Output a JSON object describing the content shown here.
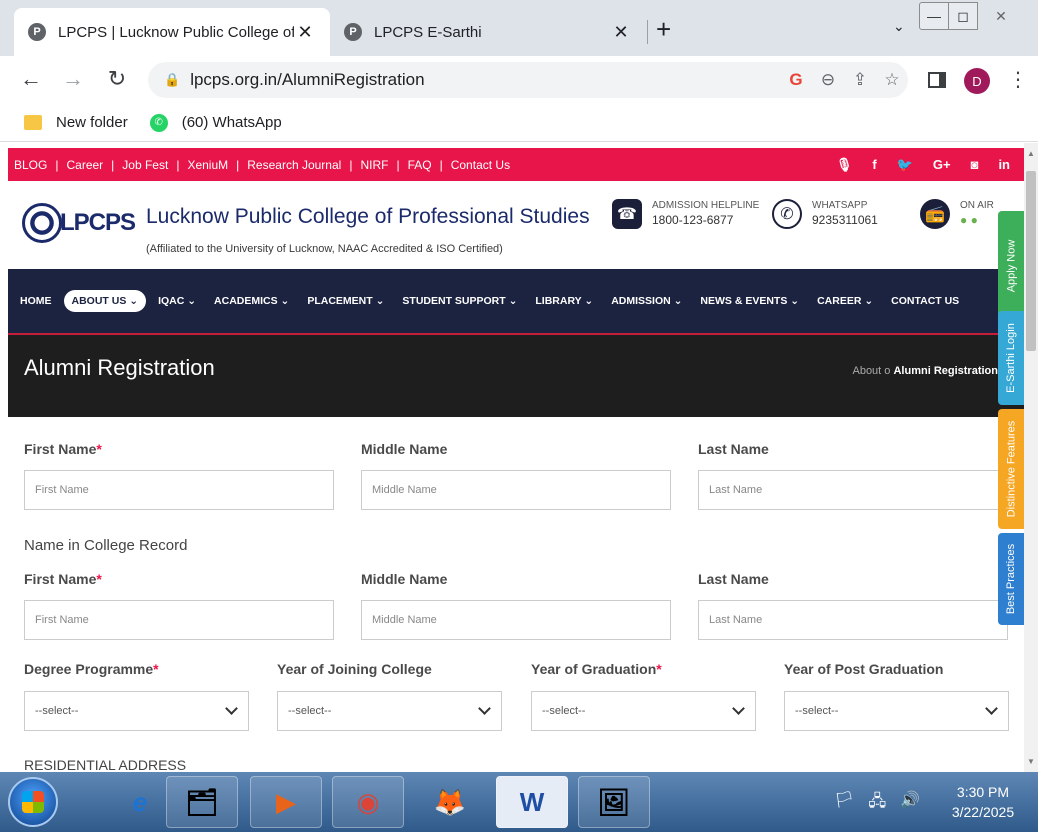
{
  "browser": {
    "tabs": [
      {
        "title": "LPCPS | Lucknow Public College of Professional Studies",
        "favicon": "P",
        "active": true
      },
      {
        "title": "LPCPS E-Sarthi",
        "favicon": "P",
        "active": false
      }
    ],
    "new_tab_symbol": "+",
    "close_symbol": "✕",
    "tab_search_symbol": "⌄",
    "window_controls": {
      "minimize": "—",
      "maximize": "◻",
      "close": "✕"
    },
    "nav": {
      "back": "←",
      "forward": "→",
      "reload": "↻"
    },
    "url": "lpcps.org.in/AlumniRegistration",
    "omnibox_icons": {
      "google": "G",
      "zoom": "⊖",
      "share": "⇪",
      "star": "☆"
    },
    "profile_initial": "D",
    "menu_symbol": "⋮",
    "bookmarks": [
      {
        "label": "New folder",
        "icon": "folder-icon"
      },
      {
        "label": "(60) WhatsApp",
        "icon": "whatsapp-icon"
      }
    ]
  },
  "site": {
    "top_links": [
      "BLOG",
      "Career",
      "Job Fest",
      "XeniuM",
      "Research Journal",
      "NIRF",
      "FAQ",
      "Contact Us"
    ],
    "top_sep": "|",
    "socials": [
      "🎙",
      "f",
      "🐦",
      "G+",
      "◙",
      "in"
    ],
    "logo_text": "LPCPS",
    "college_name": "Lucknow Public College of Professional Studies",
    "affiliation": "(Affiliated to the University of Lucknow, NAAC Accredited & ISO Certified)",
    "helpline": {
      "label": "ADMISSION HELPLINE",
      "value": "1800-123-6877",
      "icon": "☎"
    },
    "whatsapp": {
      "label": "WHATSAPP",
      "value": "9235311061",
      "icon": "✆"
    },
    "radio": {
      "label": "ON AIR",
      "icon": "📻"
    },
    "nav_items": [
      "HOME",
      "ABOUT US ⌄",
      "IQAC ⌄",
      "ACADEMICS ⌄",
      "PLACEMENT ⌄",
      "STUDENT SUPPORT ⌄",
      "LIBRARY ⌄",
      "ADMISSION ⌄",
      "NEWS & EVENTS ⌄",
      "CAREER ⌄",
      "CONTACT US"
    ],
    "page_title": "Alumni Registration",
    "breadcrumb": {
      "parent": "About",
      "sep": "o",
      "current": "Alumni Registration"
    },
    "side_tabs": [
      "Apply Now",
      "E-Sarthi Login",
      "Distinctive Features",
      "Best Practices"
    ]
  },
  "form": {
    "req_mark": "*",
    "row1": {
      "first": {
        "label": "First Name",
        "placeholder": "First Name"
      },
      "middle": {
        "label": "Middle Name",
        "placeholder": "Middle Name"
      },
      "last": {
        "label": "Last Name",
        "placeholder": "Last Name"
      }
    },
    "college_record_heading": "Name in College Record",
    "row2": {
      "first": {
        "label": "First Name",
        "placeholder": "First Name"
      },
      "middle": {
        "label": "Middle Name",
        "placeholder": "Middle Name"
      },
      "last": {
        "label": "Last Name",
        "placeholder": "Last Name"
      }
    },
    "selects": [
      {
        "label": "Degree Programme",
        "value": "--select--",
        "required": true
      },
      {
        "label": "Year of Joining College",
        "value": "--select--",
        "required": false
      },
      {
        "label": "Year of Graduation",
        "value": "--select--",
        "required": true
      },
      {
        "label": "Year of Post Graduation",
        "value": "--select--",
        "required": false
      }
    ],
    "address_heading": "RESIDENTIAL ADDRESS"
  },
  "taskbar": {
    "apps": [
      "e",
      "🗂",
      "▶",
      "◉",
      "🦊",
      "W",
      "🖼"
    ],
    "tray": [
      "🏳",
      "🖧",
      "🔊"
    ],
    "time": "3:30 PM",
    "date": "3/22/2025"
  }
}
